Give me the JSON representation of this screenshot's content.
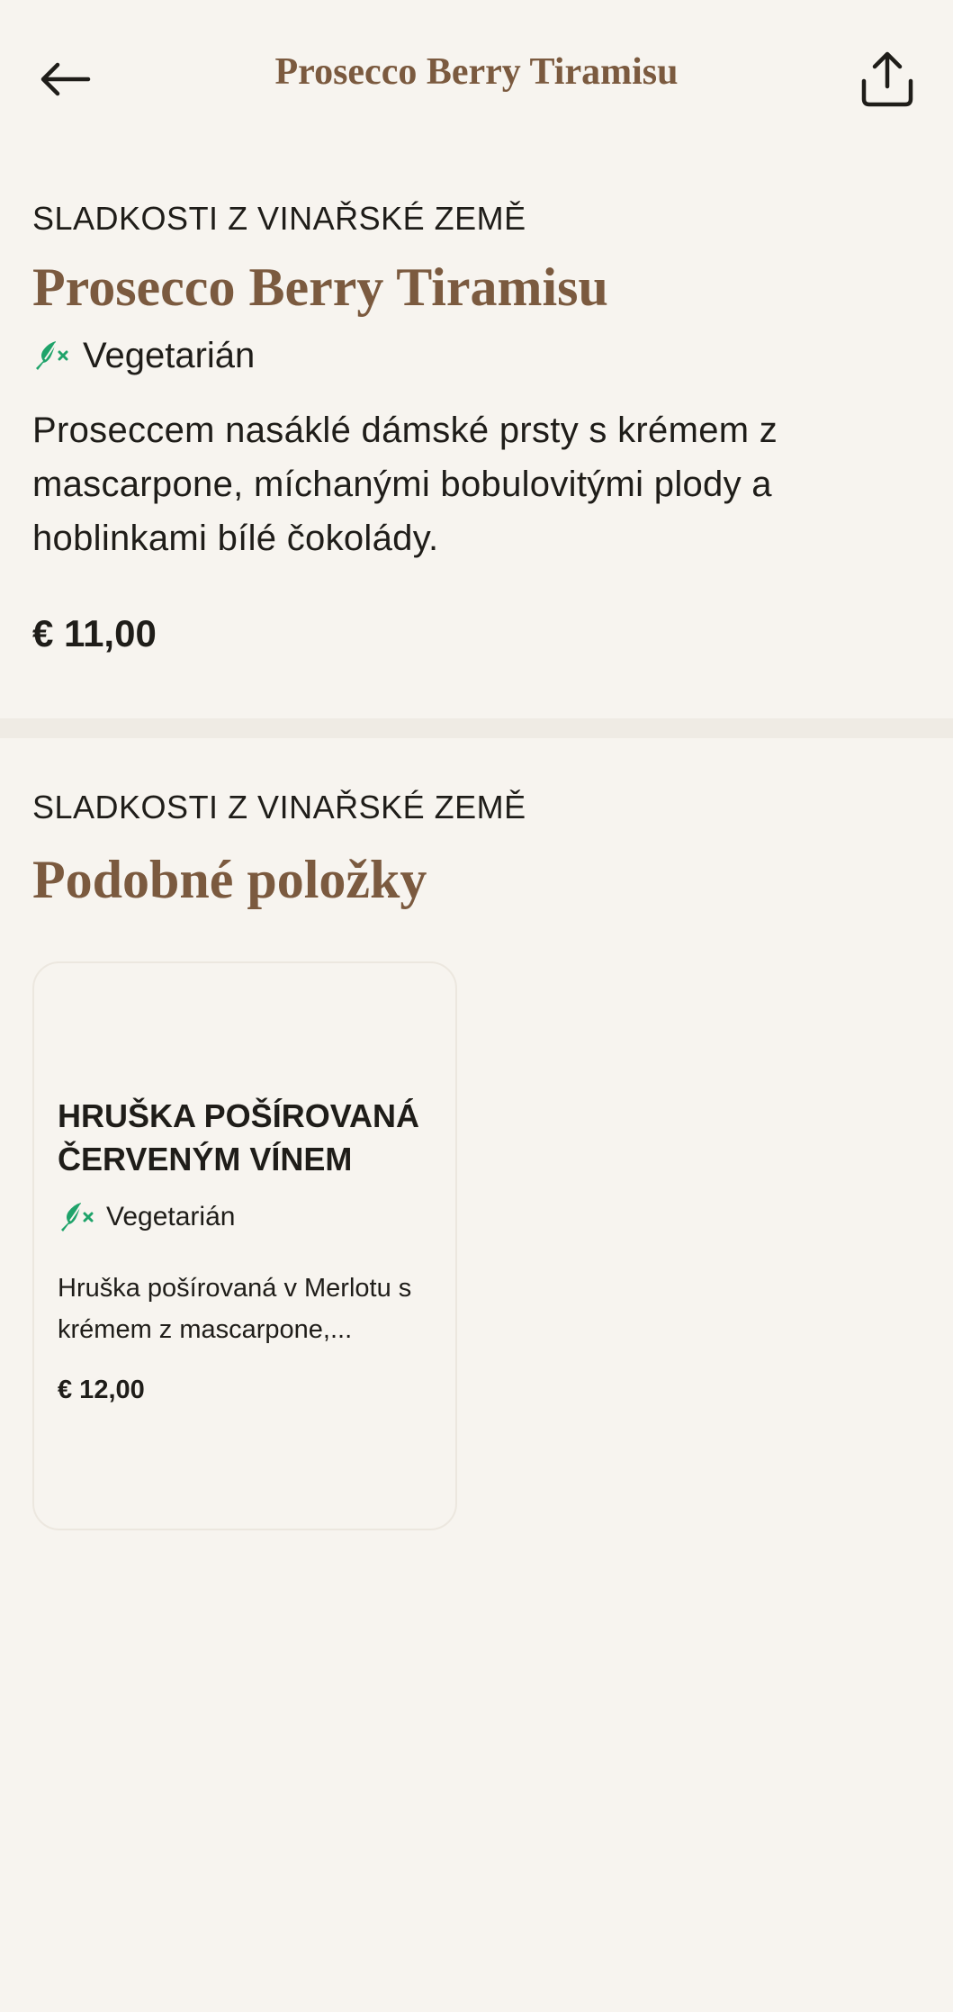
{
  "header": {
    "title": "Prosecco Berry Tiramisu",
    "back_icon": "arrow-left-icon",
    "share_icon": "share-icon"
  },
  "item": {
    "category": "SLADKOSTI Z VINAŘSKÉ ZEMĚ",
    "title": "Prosecco Berry Tiramisu",
    "diet": "Vegetarián",
    "description": "Proseccem nasáklé dámské prsty s krémem z mascarpone, míchanými bobulovitými plody a hoblinkami bílé čokolády.",
    "price": "€ 11,00"
  },
  "similar": {
    "category": "SLADKOSTI Z VINAŘSKÉ ZEMĚ",
    "title": "Podobné položky",
    "items": [
      {
        "title": "HRUŠKA POŠÍROVANÁ ČERVENÝM VÍNEM",
        "diet": "Vegetarián",
        "description": "Hruška pošírovaná v Merlotu s krémem z mascarpone,...",
        "price": "€ 12,00"
      }
    ]
  },
  "colors": {
    "background": "#f7f4ef",
    "accent_brown": "#7b5a3f",
    "diet_green": "#1fa36a",
    "divider": "#efebe4"
  }
}
